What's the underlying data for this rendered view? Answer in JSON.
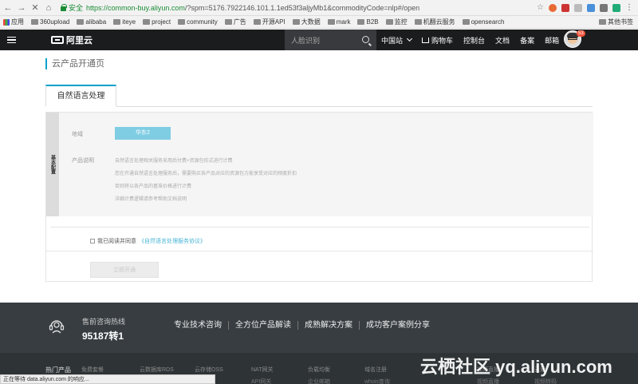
{
  "browser": {
    "secure_label": "安全",
    "url_host": "https://common-buy.aliyun.com",
    "url_rest": "/?spm=5176.7922146.101.1.1ed53f3aljyMb1&commodityCode=nlp#/open",
    "bookmarks": [
      "应用",
      "360upload",
      "alibaba",
      "iteye",
      "project",
      "community",
      "广告",
      "开源API",
      "大数据",
      "mark",
      "B2B",
      "监控",
      "机翻云服务",
      "opensearch"
    ],
    "bookmarks_right": "其他书签",
    "status_text": "正在等待 data.aliyun.com 的响应..."
  },
  "header": {
    "logo_text": "阿里云",
    "search_placeholder": "人脸识别",
    "nav": {
      "region": "中国站",
      "cart": "购物车",
      "console": "控制台",
      "docs": "文档",
      "filing": "备案",
      "mail": "邮箱"
    },
    "badge": "53"
  },
  "page": {
    "title": "云产品开通页",
    "tab": "自然语言处理",
    "side_label": "基本配置",
    "region_label": "地域",
    "region_value": "华东2",
    "desc_label": "产品说明",
    "desc_lines": [
      "自然语言处理相关服务采用后付费+资源包形式进行计费",
      "您在开通自然语言处理服务后，需要购买各产品对应的资源包方能享受对应的频度折扣",
      "否则将以各产品的基准价格进行计费",
      "详细计费逻辑请参考帮助文档说明"
    ],
    "agree_text": "我已阅读并同意",
    "agree_link": "《自然语言处理服务协议》",
    "activate_button": "立即开通"
  },
  "footer": {
    "hotline_title": "售前咨询热线",
    "hotline_number": "95187转1",
    "links": [
      "专业技术咨询",
      "全方位产品解读",
      "成熟解决方案",
      "成功客户案例分享"
    ],
    "hot_label": "热门产品",
    "hot_items": [
      "免费套餐",
      "云数据库RDS",
      "云存储OSS",
      "NAT网关",
      "负载均衡",
      "域名注册",
      "视频直播",
      "云盾"
    ],
    "hot_items_2": [
      "",
      "",
      "",
      "API网关",
      "企业邮箱",
      "whois查询",
      "视频直播",
      "视频转码"
    ]
  },
  "watermark": "云栖社区 yq.aliyun.com",
  "colors": {
    "accent": "#00a2ca",
    "header_bg": "#1b1c1e",
    "footer_bg": "#373d41",
    "region_btn": "#7fcde3"
  }
}
